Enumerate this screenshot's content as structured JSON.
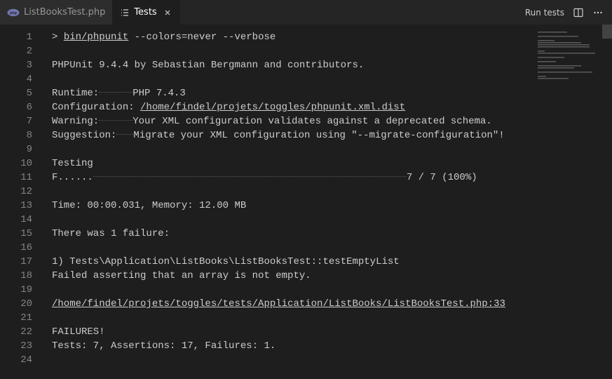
{
  "tabs": [
    {
      "label": "ListBooksTest.php",
      "active": false
    },
    {
      "label": "Tests",
      "active": true
    }
  ],
  "actions": {
    "run_label": "Run tests"
  },
  "line_count": 24,
  "content": {
    "cmd_prefix": "> ",
    "cmd_bin": "bin/phpunit",
    "cmd_args": " --colors=never --verbose",
    "phpunit_line": "PHPUnit 9.4.4 by Sebastian Bergmann and contributors.",
    "runtime_label": "Runtime:",
    "runtime_value": "PHP 7.4.3",
    "runtime_pad_width": 48,
    "config_label": "Configuration: ",
    "config_value": "/home/findel/projets/toggles/phpunit.xml.dist",
    "warning_label": "Warning:",
    "warning_value": "Your XML configuration validates against a deprecated schema.",
    "warning_pad_width": 48,
    "suggestion_label": "Suggestion:",
    "suggestion_value": "Migrate your XML configuration using \"--migrate-configuration\"!",
    "suggestion_pad_width": 24,
    "testing_label": "Testing",
    "progress_dots": "F......",
    "progress_fill_width": 447,
    "progress_summary": "7 / 7 (100%)",
    "time_memory": "Time: 00:00.031, Memory: 12.00 MB",
    "failure_header": "There was 1 failure:",
    "failure_name": "1) Tests\\Application\\ListBooks\\ListBooksTest::testEmptyList",
    "failure_msg": "Failed asserting that an array is not empty.",
    "failure_path": "/home/findel/projets/toggles/tests/Application/ListBooks/ListBooksTest.php:33",
    "failures_label": "FAILURES!",
    "stats_line": "Tests: 7, Assertions: 17, Failures: 1."
  }
}
